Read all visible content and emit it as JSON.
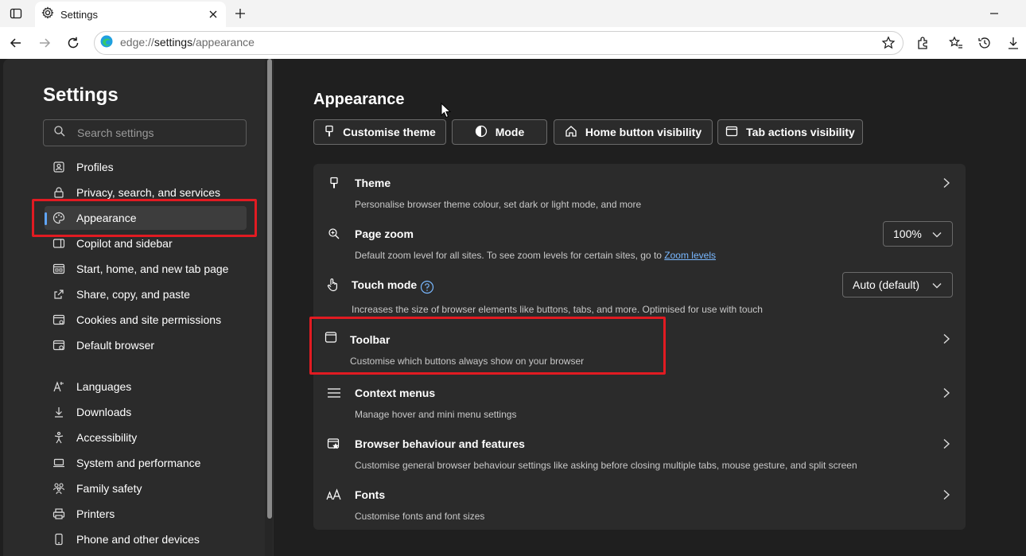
{
  "browser": {
    "tab_title": "Settings",
    "url_scheme": "edge://",
    "url_host": "settings",
    "url_path": "/appearance"
  },
  "sidebar": {
    "title": "Settings",
    "search_placeholder": "Search settings",
    "items": [
      {
        "label": "Profiles",
        "icon": "profile-icon"
      },
      {
        "label": "Privacy, search, and services",
        "icon": "lock-icon"
      },
      {
        "label": "Appearance",
        "icon": "palette-icon",
        "active": true
      },
      {
        "label": "Copilot and sidebar",
        "icon": "sidebar-icon"
      },
      {
        "label": "Start, home, and new tab page",
        "icon": "home-page-icon"
      },
      {
        "label": "Share, copy, and paste",
        "icon": "share-icon"
      },
      {
        "label": "Cookies and site permissions",
        "icon": "cookie-icon"
      },
      {
        "label": "Default browser",
        "icon": "browser-icon"
      },
      {
        "label": "Languages",
        "icon": "language-icon"
      },
      {
        "label": "Downloads",
        "icon": "download-icon"
      },
      {
        "label": "Accessibility",
        "icon": "accessibility-icon"
      },
      {
        "label": "System and performance",
        "icon": "laptop-icon"
      },
      {
        "label": "Family safety",
        "icon": "family-icon"
      },
      {
        "label": "Printers",
        "icon": "printer-icon"
      },
      {
        "label": "Phone and other devices",
        "icon": "phone-icon"
      }
    ]
  },
  "main": {
    "title": "Appearance",
    "chips": [
      {
        "label": "Customise theme",
        "icon": "brush-icon"
      },
      {
        "label": "Mode",
        "icon": "half-circle-icon"
      },
      {
        "label": "Home button visibility",
        "icon": "home-icon"
      },
      {
        "label": "Tab actions visibility",
        "icon": "tab-window-icon"
      }
    ],
    "rows": [
      {
        "title": "Theme",
        "desc": "Personalise browser theme colour, set dark or light mode, and more",
        "icon": "brush-icon"
      },
      {
        "title": "Page zoom",
        "desc": "Default zoom level for all sites. To see zoom levels for certain sites, go to ",
        "link": "Zoom levels",
        "icon": "zoom-icon",
        "dropdown": "100%"
      },
      {
        "title": "Touch mode",
        "desc": "Increases the size of browser elements like buttons, tabs, and more. Optimised for use with touch",
        "icon": "touch-icon",
        "dropdown": "Auto (default)"
      },
      {
        "title": "Toolbar",
        "desc": "Customise which buttons always show on your browser",
        "icon": "toolbar-icon"
      },
      {
        "title": "Context menus",
        "desc": "Manage hover and mini menu settings",
        "icon": "menu-icon"
      },
      {
        "title": "Browser behaviour and features",
        "desc": "Customise general browser behaviour settings like asking before closing multiple tabs, mouse gesture, and split screen",
        "icon": "features-icon"
      },
      {
        "title": "Fonts",
        "desc": "Customise fonts and font sizes",
        "icon": "fonts-icon"
      }
    ]
  },
  "colors": {
    "highlight_box": "#e11b22",
    "accent": "#60a5fa"
  }
}
